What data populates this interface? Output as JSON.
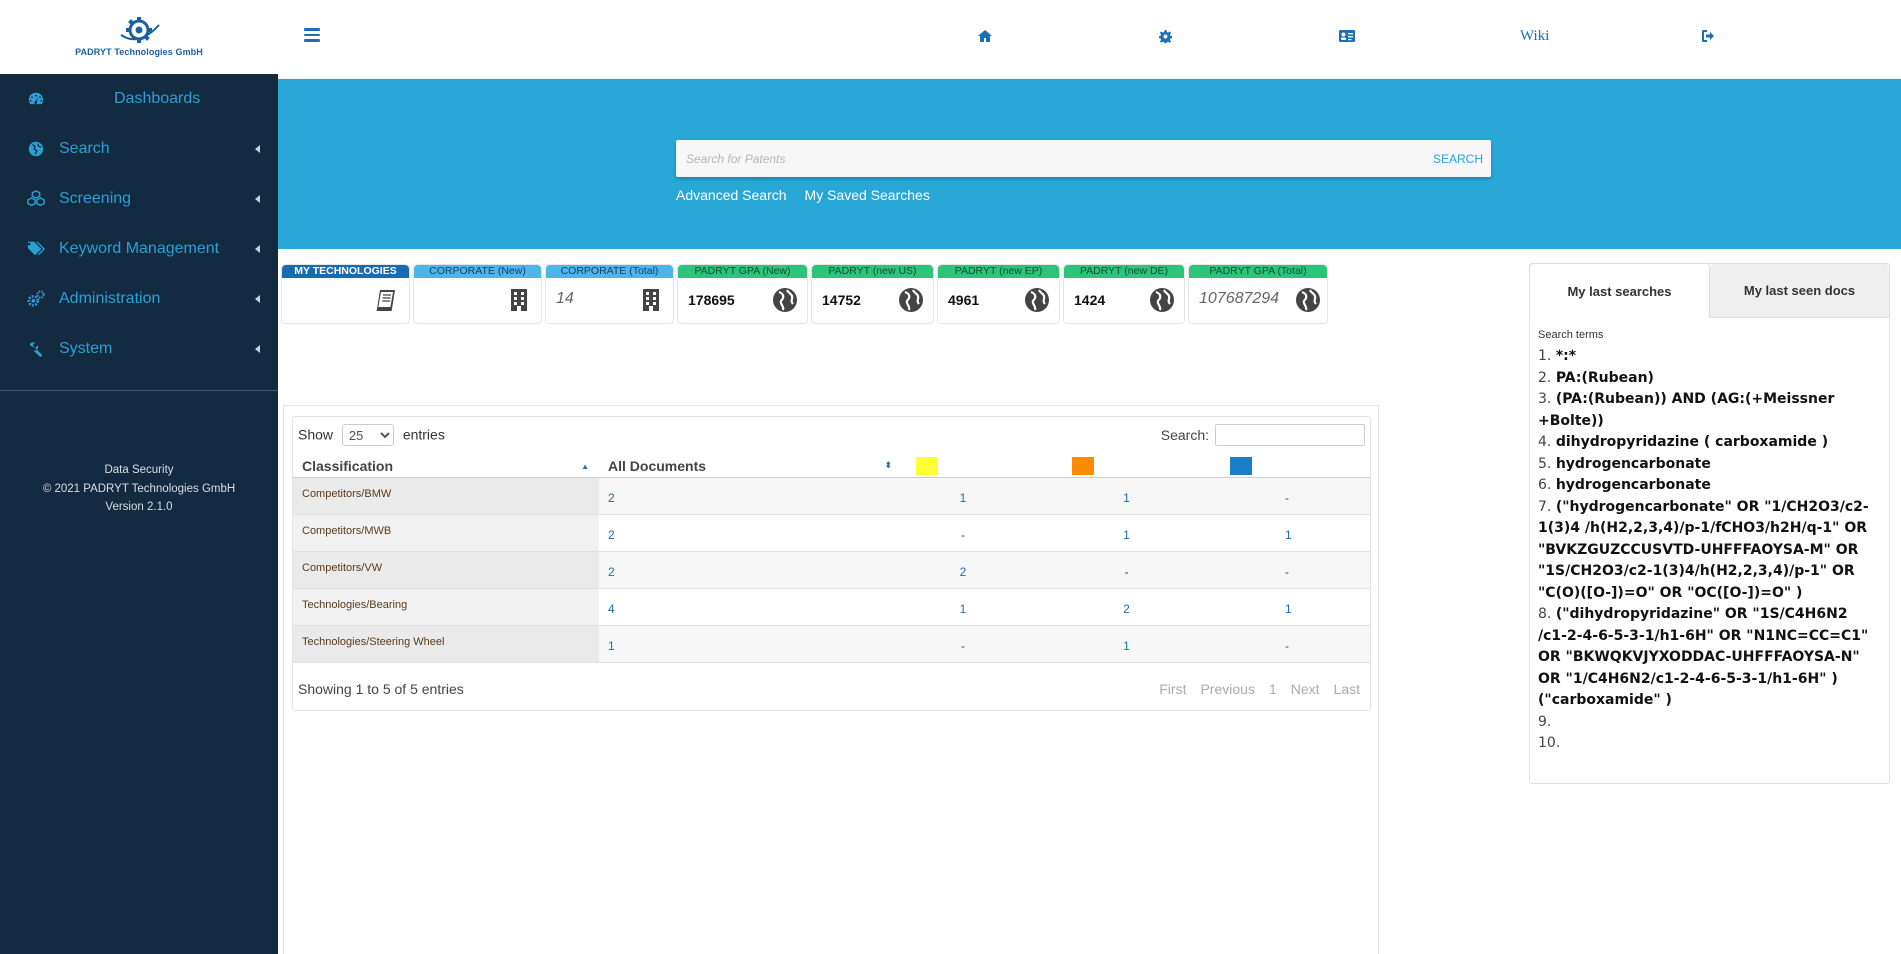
{
  "brand": {
    "name": "PADRYT Technologies GmbH"
  },
  "sidebar": {
    "items": [
      {
        "label": "Dashboards",
        "icon": "dashboard-gauge-icon"
      },
      {
        "label": "Search",
        "icon": "globe-icon"
      },
      {
        "label": "Screening",
        "icon": "cubes-icon"
      },
      {
        "label": "Keyword Management",
        "icon": "tags-icon"
      },
      {
        "label": "Administration",
        "icon": "cogs-icon"
      },
      {
        "label": "System",
        "icon": "wrench-icon"
      }
    ],
    "footer": {
      "line1": "Data Security",
      "line2": "© 2021 PADRYT Technologies GmbH",
      "line3": "Version 2.1.0"
    }
  },
  "topbar": {
    "icons": [
      "home-icon",
      "gear-icon",
      "contact-card-icon",
      "wiki-link",
      "logout-icon"
    ],
    "wiki_label": "Wiki"
  },
  "banner": {
    "search_placeholder": "Search for Patents",
    "search_button": "SEARCH",
    "advanced_search": "Advanced Search",
    "saved_searches": "My Saved Searches",
    "color": "#29a8d8"
  },
  "tiles": [
    {
      "title": "MY TECHNOLOGIES",
      "value": "",
      "icon": "book-icon",
      "style": "navy"
    },
    {
      "title": "CORPORATE (New)",
      "value": "",
      "icon": "building-icon",
      "style": "light"
    },
    {
      "title": "CORPORATE (Total)",
      "value": "14",
      "icon": "building-icon",
      "style": "light"
    },
    {
      "title": "PADRYT GPA (New)",
      "value": "178695",
      "icon": "globe-icon",
      "style": "green"
    },
    {
      "title": "PADRYT (new US)",
      "value": "14752",
      "icon": "globe-icon",
      "style": "green"
    },
    {
      "title": "PADRYT (new EP)",
      "value": "4961",
      "icon": "globe-icon",
      "style": "green"
    },
    {
      "title": "PADRYT (new DE)",
      "value": "1424",
      "icon": "globe-icon",
      "style": "green"
    },
    {
      "title": "PADRYT GPA (Total)",
      "value": "107687294",
      "icon": "globe-icon",
      "style": "green"
    }
  ],
  "table": {
    "show_label": "Show",
    "page_size": "25",
    "entries_label": "entries",
    "search_label": "Search:",
    "headers": [
      "Classification",
      "All Documents"
    ],
    "swatch_colors": [
      "#ffff33",
      "#ff8c00",
      "#1a7fc7"
    ],
    "rows": [
      {
        "cls": "Competitors/BMW",
        "all": "2",
        "c1": "1",
        "c2": "1",
        "c3": "-"
      },
      {
        "cls": "Competitors/MWB",
        "all": "2",
        "c1": "-",
        "c2": "1",
        "c3": "1"
      },
      {
        "cls": "Competitors/VW",
        "all": "2",
        "c1": "2",
        "c2": "-",
        "c3": "-"
      },
      {
        "cls": "Technologies/Bearing",
        "all": "4",
        "c1": "1",
        "c2": "2",
        "c3": "1"
      },
      {
        "cls": "Technologies/Steering Wheel",
        "all": "1",
        "c1": "-",
        "c2": "1",
        "c3": "-"
      }
    ],
    "info": "Showing 1 to 5 of 5 entries",
    "pager": {
      "first": "First",
      "previous": "Previous",
      "page": "1",
      "next": "Next",
      "last": "Last"
    }
  },
  "right_panel": {
    "tab_active": "My last searches",
    "tab_inactive": "My last seen docs",
    "label": "Search terms",
    "searches": [
      {
        "n": "1.",
        "q": "*:*"
      },
      {
        "n": "2.",
        "q": "PA:(Rubean)"
      },
      {
        "n": "3.",
        "q": "(PA:(Rubean)) AND (AG:(+Meissner +Bolte))"
      },
      {
        "n": "4.",
        "q": "dihydropyridazine ( carboxamide )"
      },
      {
        "n": "5.",
        "q": "hydrogencarbonate"
      },
      {
        "n": "6.",
        "q": "hydrogencarbonate"
      },
      {
        "n": "7.",
        "q": "(\"hydrogencarbonate\" OR \"1/CH2O3/c2-1(3)4 /h(H2,2,3,4)/p-1/fCHO3/h2H/q-1\" OR \"BVKZGUZCCUSVTD-UHFFFAOYSA-M\" OR \"1S/CH2O3/c2-1(3)4/h(H2,2,3,4)/p-1\" OR \"C(O)([O-])=O\" OR \"OC([O-])=O\" )"
      },
      {
        "n": "8.",
        "q": "(\"dihydropyridazine\" OR \"1S/C4H6N2 /c1-2-4-6-5-3-1/h1-6H\" OR \"N1NC=CC=C1\" OR \"BKWQKVJYXODDAC-UHFFFAOYSA-N\" OR \"1/C4H6N2/c1-2-4-6-5-3-1/h1-6H\" ) (\"carboxamide\" )"
      },
      {
        "n": "9.",
        "q": ""
      },
      {
        "n": "10.",
        "q": ""
      }
    ]
  }
}
